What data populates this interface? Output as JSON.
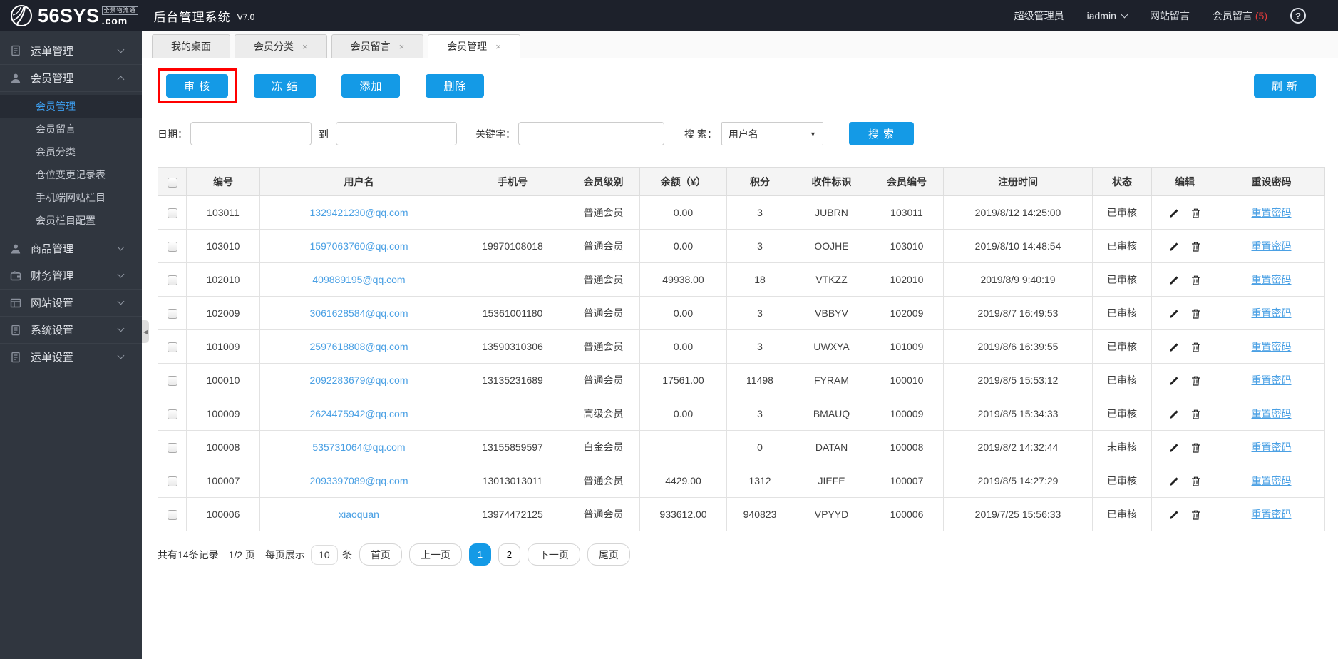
{
  "topbar": {
    "logo_text": "56SYS",
    "logo_tagline": "全景物流通",
    "logo_suffix": ".com",
    "app_title": "后台管理系统",
    "version": "V7.0",
    "role": "超级管理员",
    "username": "iadmin",
    "site_messages": "网站留言",
    "member_messages": "会员留言",
    "member_messages_count": "(5)"
  },
  "icons": {
    "close": "×",
    "dropdown": "▼",
    "question": "?",
    "collapse": "◀"
  },
  "sidebar": {
    "items": [
      {
        "label": "运单管理"
      },
      {
        "label": "会员管理"
      },
      {
        "label": "商品管理"
      },
      {
        "label": "财务管理"
      },
      {
        "label": "网站设置"
      },
      {
        "label": "系统设置"
      },
      {
        "label": "运单设置"
      }
    ],
    "submenu": [
      "会员管理",
      "会员留言",
      "会员分类",
      "仓位变更记录表",
      "手机端网站栏目",
      "会员栏目配置"
    ]
  },
  "tabs": [
    {
      "label": "我的桌面"
    },
    {
      "label": "会员分类"
    },
    {
      "label": "会员留言"
    },
    {
      "label": "会员管理"
    }
  ],
  "toolbar": {
    "audit": "审 核",
    "freeze": "冻 结",
    "add": "添加",
    "delete": "删除",
    "refresh": "刷 新"
  },
  "filter": {
    "date_label": "日期：",
    "to_label": "到",
    "keyword_label": "关键字：",
    "search_label": "搜 索：",
    "search_type": "用户名",
    "search_button": "搜 索",
    "date_from": "",
    "date_to": "",
    "keyword": ""
  },
  "table": {
    "headers": [
      "编号",
      "用户名",
      "手机号",
      "会员级别",
      "余额（¥）",
      "积分",
      "收件标识",
      "会员编号",
      "注册时间",
      "状态",
      "编辑",
      "重设密码"
    ],
    "reset_link": "重置密码",
    "rows": [
      {
        "id": "103011",
        "username": "1329421230@qq.com",
        "phone": "",
        "level": "普通会员",
        "balance": "0.00",
        "points": "3",
        "code": "JUBRN",
        "member_no": "103011",
        "registered": "2019/8/12 14:25:00",
        "status": "已审核"
      },
      {
        "id": "103010",
        "username": "1597063760@qq.com",
        "phone": "19970108018",
        "level": "普通会员",
        "balance": "0.00",
        "points": "3",
        "code": "OOJHE",
        "member_no": "103010",
        "registered": "2019/8/10 14:48:54",
        "status": "已审核"
      },
      {
        "id": "102010",
        "username": "409889195@qq.com",
        "phone": "",
        "level": "普通会员",
        "balance": "49938.00",
        "points": "18",
        "code": "VTKZZ",
        "member_no": "102010",
        "registered": "2019/8/9 9:40:19",
        "status": "已审核"
      },
      {
        "id": "102009",
        "username": "3061628584@qq.com",
        "phone": "15361001180",
        "level": "普通会员",
        "balance": "0.00",
        "points": "3",
        "code": "VBBYV",
        "member_no": "102009",
        "registered": "2019/8/7 16:49:53",
        "status": "已审核"
      },
      {
        "id": "101009",
        "username": "2597618808@qq.com",
        "phone": "13590310306",
        "level": "普通会员",
        "balance": "0.00",
        "points": "3",
        "code": "UWXYA",
        "member_no": "101009",
        "registered": "2019/8/6 16:39:55",
        "status": "已审核"
      },
      {
        "id": "100010",
        "username": "2092283679@qq.com",
        "phone": "13135231689",
        "level": "普通会员",
        "balance": "17561.00",
        "points": "11498",
        "code": "FYRAM",
        "member_no": "100010",
        "registered": "2019/8/5 15:53:12",
        "status": "已审核"
      },
      {
        "id": "100009",
        "username": "2624475942@qq.com",
        "phone": "",
        "level": "高级会员",
        "balance": "0.00",
        "points": "3",
        "code": "BMAUQ",
        "member_no": "100009",
        "registered": "2019/8/5 15:34:33",
        "status": "已审核"
      },
      {
        "id": "100008",
        "username": "535731064@qq.com",
        "phone": "13155859597",
        "level": "白金会员",
        "balance": "",
        "points": "0",
        "code": "DATAN",
        "member_no": "100008",
        "registered": "2019/8/2 14:32:44",
        "status": "未审核"
      },
      {
        "id": "100007",
        "username": "2093397089@qq.com",
        "phone": "13013013011",
        "level": "普通会员",
        "balance": "4429.00",
        "points": "1312",
        "code": "JIEFE",
        "member_no": "100007",
        "registered": "2019/8/5 14:27:29",
        "status": "已审核"
      },
      {
        "id": "100006",
        "username": "xiaoquan",
        "phone": "13974472125",
        "level": "普通会员",
        "balance": "933612.00",
        "points": "940823",
        "code": "VPYYD",
        "member_no": "100006",
        "registered": "2019/7/25 15:56:33",
        "status": "已审核"
      }
    ]
  },
  "pagination": {
    "summary": "共有14条记录",
    "page_info": "1/2 页",
    "per_page_label": "每页展示",
    "per_page": "10",
    "unit": "条",
    "first": "首页",
    "prev": "上一页",
    "pages": [
      "1",
      "2"
    ],
    "next": "下一页",
    "last": "尾页"
  },
  "colors": {
    "accent": "#149ae6",
    "link": "#4aa0e4",
    "badge": "#e23b3b",
    "annotation": "#ff0000"
  }
}
